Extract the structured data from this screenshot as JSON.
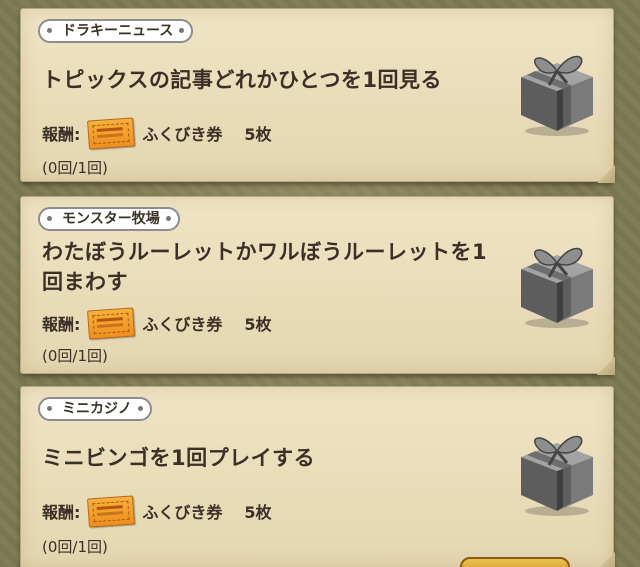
{
  "missions": [
    {
      "category": "ドラキーニュース",
      "title": "トピックスの記事どれかひとつを1回見る",
      "reward_label": "報酬:",
      "reward_item": "ふくびき券",
      "reward_count": "5枚",
      "progress": "(0回/1回)",
      "icon": "gift-box-icon"
    },
    {
      "category": "モンスター牧場",
      "title": "わたぼうルーレットかワルぼうルーレットを1回まわす",
      "reward_label": "報酬:",
      "reward_item": "ふくびき券",
      "reward_count": "5枚",
      "progress": "(0回/1回)",
      "icon": "gift-box-icon"
    },
    {
      "category": "ミニカジノ",
      "title": "ミニビンゴを1回プレイする",
      "reward_label": "報酬:",
      "reward_item": "ふくびき券",
      "reward_count": "5枚",
      "progress": "(0回/1回)",
      "icon": "gift-box-icon"
    }
  ],
  "colors": {
    "background": "#7d7a55",
    "card": "#ece0bf",
    "text": "#3a3026",
    "ticket": "#f2a02e",
    "gift": "#6f6f6f"
  }
}
